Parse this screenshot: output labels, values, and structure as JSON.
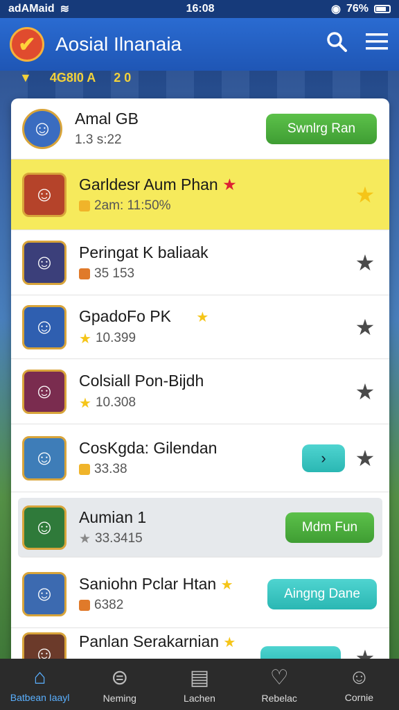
{
  "status_bar": {
    "carrier": "adAMaid",
    "time": "16:08",
    "battery": "76%"
  },
  "header": {
    "title": "Aosial Ilnanaia",
    "search_icon": "search-icon",
    "menu_icon": "menu-icon"
  },
  "subbar": {
    "text1": "4G8I0 A",
    "text2": "2 0"
  },
  "list": [
    {
      "name": "Amal GB",
      "sub": "1.3 s:22",
      "button": "Swnlrg Ran",
      "variant": "plain"
    },
    {
      "name": "Garldesr Aum Phan",
      "sub": "2am: 11:50%",
      "variant": "highlight"
    },
    {
      "name": "Peringat K baliaak",
      "sub": "35 153",
      "variant": "plain"
    },
    {
      "name": "GpadoFo PK",
      "sub": "10.399",
      "variant": "plain"
    },
    {
      "name": "Colsiall Pon-Bijdh",
      "sub": "10.308",
      "variant": "plain"
    },
    {
      "name": "CosKgda: Gilendan",
      "sub": "33.38",
      "variant": "plain"
    },
    {
      "name": "Aumian 1",
      "sub": "33.3415",
      "button": "Mdm Fun",
      "variant": "grey"
    },
    {
      "name": "Saniohn Pclar Htan",
      "sub": "6382",
      "button": "Aingng Dane",
      "variant": "plain"
    },
    {
      "name": "Panlan Serakarnian",
      "sub": "",
      "variant": "plain"
    }
  ],
  "nav": [
    {
      "label": "Batbean Iaayl",
      "icon": "home-icon"
    },
    {
      "label": "Neming",
      "icon": "compass-icon"
    },
    {
      "label": "Lachen",
      "icon": "list-icon"
    },
    {
      "label": "Rebelac",
      "icon": "heart-icon"
    },
    {
      "label": "Cornie",
      "icon": "profile-icon"
    }
  ],
  "colors": {
    "header": "#2a6bd1",
    "highlight_row": "#f6ea5c",
    "green_button": "#4caf3f",
    "teal_button": "#36c2be",
    "nav_active": "#5ab0ff"
  }
}
